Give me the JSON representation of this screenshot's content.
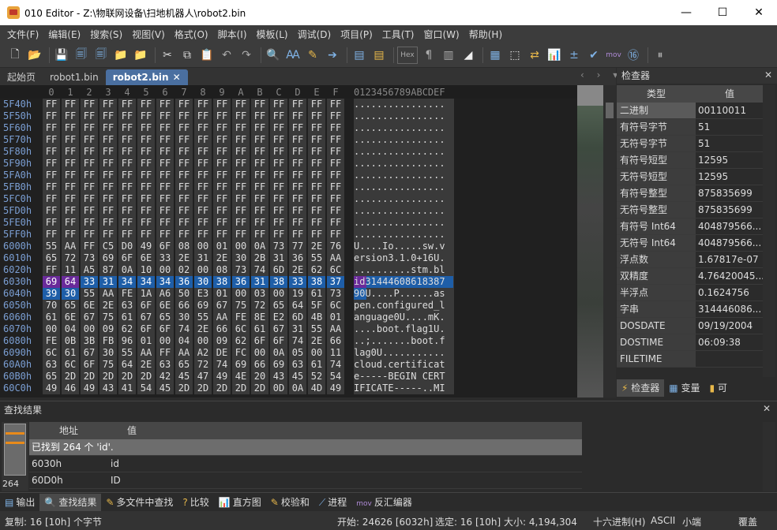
{
  "window": {
    "title": "010 Editor - Z:\\物联网设备\\扫地机器人\\robot2.bin",
    "min": "—",
    "max": "☐",
    "close": "✕"
  },
  "menu": [
    "文件(F)",
    "编辑(E)",
    "搜索(S)",
    "视图(V)",
    "格式(O)",
    "脚本(I)",
    "模板(L)",
    "调试(D)",
    "项目(P)",
    "工具(T)",
    "窗口(W)",
    "帮助(H)"
  ],
  "toolbar": {
    "hex_label": "Hex",
    "mov_label": "mov"
  },
  "tabs": [
    {
      "label": "起始页",
      "active": false
    },
    {
      "label": "robot1.bin",
      "active": false
    },
    {
      "label": "robot2.bin",
      "active": true
    }
  ],
  "hex": {
    "col_headers": [
      "0",
      "1",
      "2",
      "3",
      "4",
      "5",
      "6",
      "7",
      "8",
      "9",
      "A",
      "B",
      "C",
      "D",
      "E",
      "F"
    ],
    "ascii_header": "0123456789ABCDEF",
    "rows": [
      {
        "addr": "5F40h",
        "bytes": [
          "FF",
          "FF",
          "FF",
          "FF",
          "FF",
          "FF",
          "FF",
          "FF",
          "FF",
          "FF",
          "FF",
          "FF",
          "FF",
          "FF",
          "FF",
          "FF"
        ],
        "ascii": "................"
      },
      {
        "addr": "5F50h",
        "bytes": [
          "FF",
          "FF",
          "FF",
          "FF",
          "FF",
          "FF",
          "FF",
          "FF",
          "FF",
          "FF",
          "FF",
          "FF",
          "FF",
          "FF",
          "FF",
          "FF"
        ],
        "ascii": "................"
      },
      {
        "addr": "5F60h",
        "bytes": [
          "FF",
          "FF",
          "FF",
          "FF",
          "FF",
          "FF",
          "FF",
          "FF",
          "FF",
          "FF",
          "FF",
          "FF",
          "FF",
          "FF",
          "FF",
          "FF"
        ],
        "ascii": "................"
      },
      {
        "addr": "5F70h",
        "bytes": [
          "FF",
          "FF",
          "FF",
          "FF",
          "FF",
          "FF",
          "FF",
          "FF",
          "FF",
          "FF",
          "FF",
          "FF",
          "FF",
          "FF",
          "FF",
          "FF"
        ],
        "ascii": "................"
      },
      {
        "addr": "5F80h",
        "bytes": [
          "FF",
          "FF",
          "FF",
          "FF",
          "FF",
          "FF",
          "FF",
          "FF",
          "FF",
          "FF",
          "FF",
          "FF",
          "FF",
          "FF",
          "FF",
          "FF"
        ],
        "ascii": "................"
      },
      {
        "addr": "5F90h",
        "bytes": [
          "FF",
          "FF",
          "FF",
          "FF",
          "FF",
          "FF",
          "FF",
          "FF",
          "FF",
          "FF",
          "FF",
          "FF",
          "FF",
          "FF",
          "FF",
          "FF"
        ],
        "ascii": "................"
      },
      {
        "addr": "5FA0h",
        "bytes": [
          "FF",
          "FF",
          "FF",
          "FF",
          "FF",
          "FF",
          "FF",
          "FF",
          "FF",
          "FF",
          "FF",
          "FF",
          "FF",
          "FF",
          "FF",
          "FF"
        ],
        "ascii": "................"
      },
      {
        "addr": "5FB0h",
        "bytes": [
          "FF",
          "FF",
          "FF",
          "FF",
          "FF",
          "FF",
          "FF",
          "FF",
          "FF",
          "FF",
          "FF",
          "FF",
          "FF",
          "FF",
          "FF",
          "FF"
        ],
        "ascii": "................"
      },
      {
        "addr": "5FC0h",
        "bytes": [
          "FF",
          "FF",
          "FF",
          "FF",
          "FF",
          "FF",
          "FF",
          "FF",
          "FF",
          "FF",
          "FF",
          "FF",
          "FF",
          "FF",
          "FF",
          "FF"
        ],
        "ascii": "................"
      },
      {
        "addr": "5FD0h",
        "bytes": [
          "FF",
          "FF",
          "FF",
          "FF",
          "FF",
          "FF",
          "FF",
          "FF",
          "FF",
          "FF",
          "FF",
          "FF",
          "FF",
          "FF",
          "FF",
          "FF"
        ],
        "ascii": "................"
      },
      {
        "addr": "5FE0h",
        "bytes": [
          "FF",
          "FF",
          "FF",
          "FF",
          "FF",
          "FF",
          "FF",
          "FF",
          "FF",
          "FF",
          "FF",
          "FF",
          "FF",
          "FF",
          "FF",
          "FF"
        ],
        "ascii": "................"
      },
      {
        "addr": "5FF0h",
        "bytes": [
          "FF",
          "FF",
          "FF",
          "FF",
          "FF",
          "FF",
          "FF",
          "FF",
          "FF",
          "FF",
          "FF",
          "FF",
          "FF",
          "FF",
          "FF",
          "FF"
        ],
        "ascii": "................"
      },
      {
        "addr": "6000h",
        "bytes": [
          "55",
          "AA",
          "FF",
          "C5",
          "D0",
          "49",
          "6F",
          "08",
          "00",
          "01",
          "00",
          "0A",
          "73",
          "77",
          "2E",
          "76"
        ],
        "ascii": "U....Io.....sw.v"
      },
      {
        "addr": "6010h",
        "bytes": [
          "65",
          "72",
          "73",
          "69",
          "6F",
          "6E",
          "33",
          "2E",
          "31",
          "2E",
          "30",
          "2B",
          "31",
          "36",
          "55",
          "AA"
        ],
        "ascii": "ersion3.1.0+16U."
      },
      {
        "addr": "6020h",
        "bytes": [
          "FF",
          "11",
          "A5",
          "87",
          "0A",
          "10",
          "00",
          "02",
          "00",
          "08",
          "73",
          "74",
          "6D",
          "2E",
          "62",
          "6C"
        ],
        "ascii": "..........stm.bl"
      },
      {
        "addr": "6030h",
        "bytes": [
          "69",
          "64",
          "33",
          "31",
          "34",
          "34",
          "34",
          "36",
          "30",
          "38",
          "36",
          "31",
          "38",
          "33",
          "38",
          "37"
        ],
        "ascii": "id31444608618387",
        "sel": "all",
        "purple": [
          0,
          1
        ]
      },
      {
        "addr": "6040h",
        "bytes": [
          "39",
          "30",
          "55",
          "AA",
          "FE",
          "1A",
          "A6",
          "50",
          "E3",
          "01",
          "00",
          "03",
          "00",
          "19",
          "61",
          "73"
        ],
        "ascii": "90U....P......as",
        "sel": [
          0,
          1
        ]
      },
      {
        "addr": "6050h",
        "bytes": [
          "70",
          "65",
          "6E",
          "2E",
          "63",
          "6F",
          "6E",
          "66",
          "69",
          "67",
          "75",
          "72",
          "65",
          "64",
          "5F",
          "6C"
        ],
        "ascii": "pen.configured_l"
      },
      {
        "addr": "6060h",
        "bytes": [
          "61",
          "6E",
          "67",
          "75",
          "61",
          "67",
          "65",
          "30",
          "55",
          "AA",
          "FE",
          "8E",
          "E2",
          "6D",
          "4B",
          "01"
        ],
        "ascii": "anguage0U....mK."
      },
      {
        "addr": "6070h",
        "bytes": [
          "00",
          "04",
          "00",
          "09",
          "62",
          "6F",
          "6F",
          "74",
          "2E",
          "66",
          "6C",
          "61",
          "67",
          "31",
          "55",
          "AA"
        ],
        "ascii": "....boot.flag1U."
      },
      {
        "addr": "6080h",
        "bytes": [
          "FE",
          "0B",
          "3B",
          "FB",
          "96",
          "01",
          "00",
          "04",
          "00",
          "09",
          "62",
          "6F",
          "6F",
          "74",
          "2E",
          "66"
        ],
        "ascii": "..;.......boot.f"
      },
      {
        "addr": "6090h",
        "bytes": [
          "6C",
          "61",
          "67",
          "30",
          "55",
          "AA",
          "FF",
          "AA",
          "A2",
          "DE",
          "FC",
          "00",
          "0A",
          "05",
          "00",
          "11"
        ],
        "ascii": "lag0U..........."
      },
      {
        "addr": "60A0h",
        "bytes": [
          "63",
          "6C",
          "6F",
          "75",
          "64",
          "2E",
          "63",
          "65",
          "72",
          "74",
          "69",
          "66",
          "69",
          "63",
          "61",
          "74"
        ],
        "ascii": "cloud.certificat"
      },
      {
        "addr": "60B0h",
        "bytes": [
          "65",
          "2D",
          "2D",
          "2D",
          "2D",
          "2D",
          "42",
          "45",
          "47",
          "49",
          "4E",
          "20",
          "43",
          "45",
          "52",
          "54"
        ],
        "ascii": "e-----BEGIN CERT"
      },
      {
        "addr": "60C0h",
        "bytes": [
          "49",
          "46",
          "49",
          "43",
          "41",
          "54",
          "45",
          "2D",
          "2D",
          "2D",
          "2D",
          "2D",
          "0D",
          "0A",
          "4D",
          "49"
        ],
        "ascii": "IFICATE-----..MI"
      }
    ]
  },
  "inspector": {
    "title": "检查器",
    "close": "✕",
    "headers": [
      "类型",
      "值"
    ],
    "rows": [
      {
        "k": "二进制",
        "v": "00110011"
      },
      {
        "k": "有符号字节",
        "v": "51"
      },
      {
        "k": "无符号字节",
        "v": "51"
      },
      {
        "k": "有符号短型",
        "v": "12595"
      },
      {
        "k": "无符号短型",
        "v": "12595"
      },
      {
        "k": "有符号整型",
        "v": "875835699"
      },
      {
        "k": "无符号整型",
        "v": "875835699"
      },
      {
        "k": "有符号 Int64",
        "v": "404879566..."
      },
      {
        "k": "无符号 Int64",
        "v": "404879566..."
      },
      {
        "k": "浮点数",
        "v": "1.67817e-07"
      },
      {
        "k": "双精度",
        "v": "4.76420045..."
      },
      {
        "k": "半浮点",
        "v": "0.1624756"
      },
      {
        "k": "字串",
        "v": "314446086..."
      },
      {
        "k": "DOSDATE",
        "v": "09/19/2004"
      },
      {
        "k": "DOSTIME",
        "v": "06:09:38"
      },
      {
        "k": "FILETIME",
        "v": ""
      }
    ],
    "tabs": [
      "检查器",
      "变量",
      "可"
    ]
  },
  "find": {
    "title": "查找结果",
    "close": "✕",
    "count": "264",
    "headers": [
      "地址",
      "值"
    ],
    "summary": "已找到 264 个 'id'.",
    "rows": [
      {
        "addr": "6030h",
        "val": "id"
      },
      {
        "addr": "60D0h",
        "val": "ID"
      }
    ]
  },
  "bottom_tabs": [
    {
      "label": "输出",
      "active": false
    },
    {
      "label": "查找结果",
      "active": true
    },
    {
      "label": "多文件中查找",
      "active": false
    },
    {
      "label": "比较",
      "active": false
    },
    {
      "label": "直方图",
      "active": false
    },
    {
      "label": "校验和",
      "active": false
    },
    {
      "label": "进程",
      "active": false
    },
    {
      "label": "反汇编器",
      "active": false
    }
  ],
  "status": {
    "selected": "复制: 16 [10h] 个字节",
    "start": "开始: 24626 [6032h]",
    "sel": "选定: 16 [10h]",
    "size": "大小: 4,194,304",
    "mode": "十六进制(H)",
    "enc": "ASCII",
    "endian": "小端",
    "ovr": "覆盖"
  }
}
